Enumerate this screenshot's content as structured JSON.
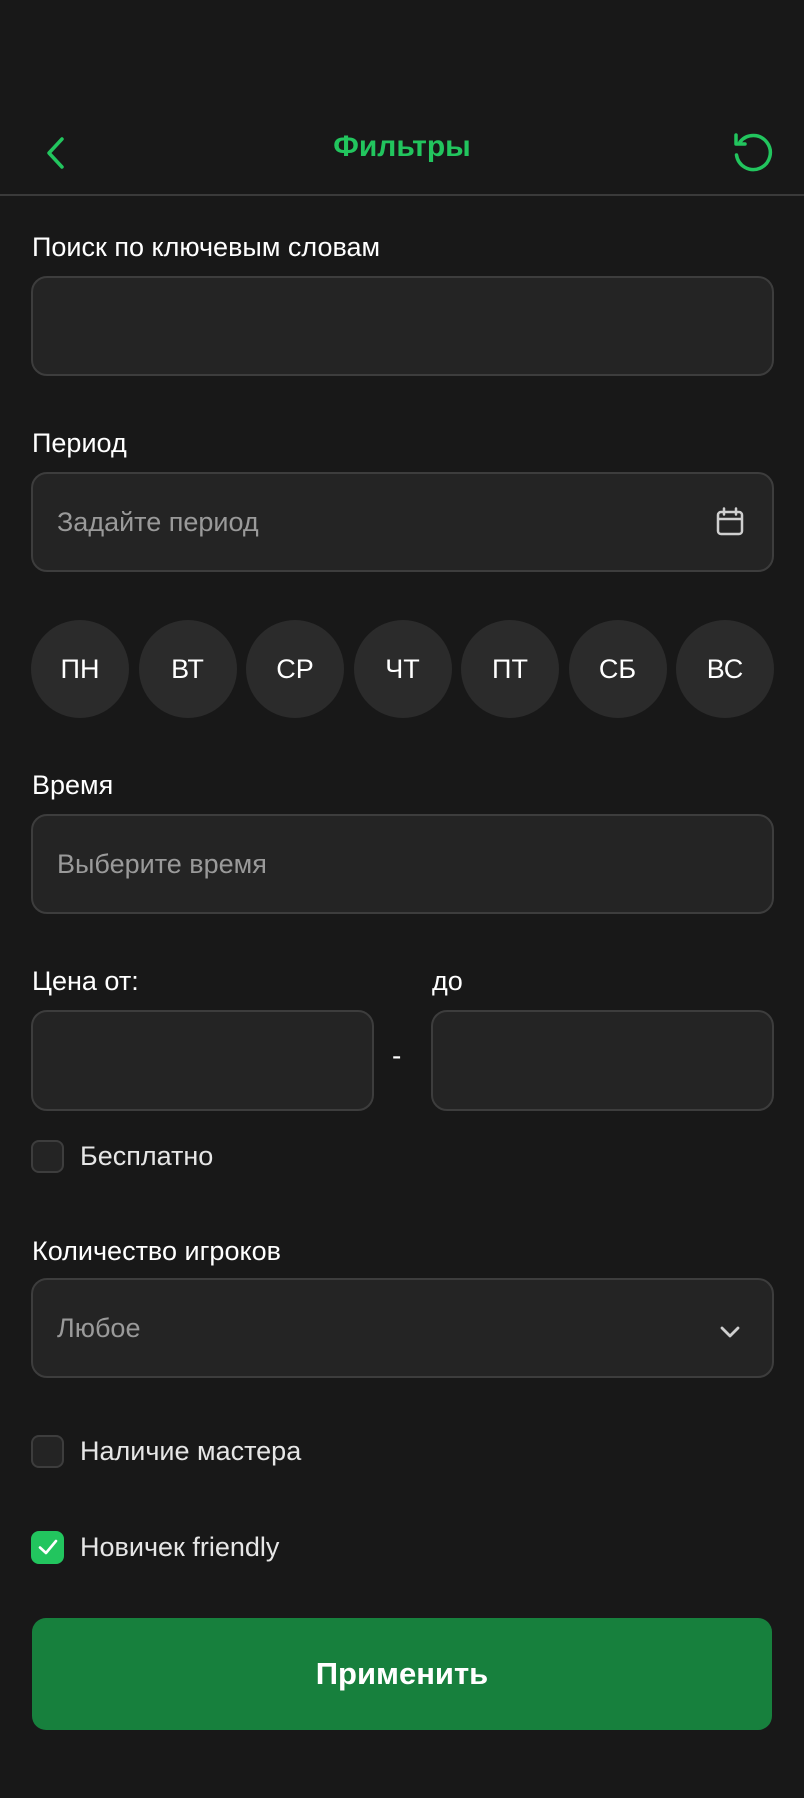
{
  "header": {
    "title": "Фильтры",
    "back_icon": "chevron-left-icon",
    "reset_icon": "refresh-icon"
  },
  "keyword_search": {
    "label": "Поиск по ключевым словам",
    "value": "",
    "placeholder": ""
  },
  "period": {
    "label": "Период",
    "placeholder": "Задайте период",
    "icon": "calendar-icon"
  },
  "weekdays": [
    "ПН",
    "ВТ",
    "СР",
    "ЧТ",
    "ПТ",
    "СБ",
    "ВС"
  ],
  "time": {
    "label": "Время",
    "placeholder": "Выберите время"
  },
  "price": {
    "from_label": "Цена от:",
    "to_label": "до",
    "separator": "-",
    "from_value": "",
    "to_value": ""
  },
  "free_checkbox": {
    "label": "Бесплатно",
    "checked": false
  },
  "players": {
    "label": "Количество игроков",
    "selected": "Любое",
    "icon": "chevron-down-icon"
  },
  "master_checkbox": {
    "label": "Наличие мастера",
    "checked": false
  },
  "newbie_checkbox": {
    "label": "Новичек friendly",
    "checked": true
  },
  "apply_button": {
    "label": "Применить"
  },
  "colors": {
    "accent": "#22c55e",
    "button": "#17803d",
    "background": "#181818",
    "field": "#242424"
  }
}
